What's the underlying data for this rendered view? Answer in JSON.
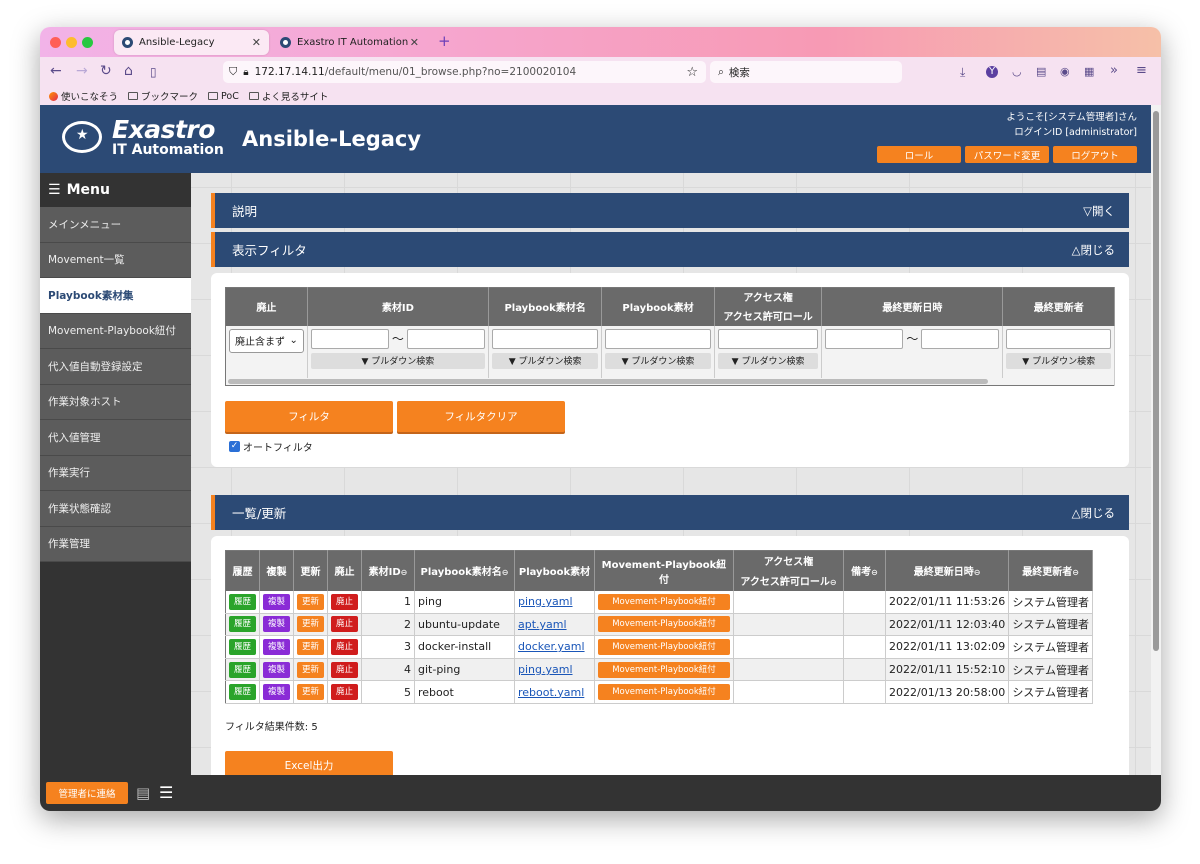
{
  "browser": {
    "tabs": [
      {
        "label": "Ansible-Legacy"
      },
      {
        "label": "Exastro IT Automation"
      }
    ],
    "new_tab": "+",
    "url_host": "172.17.14.11",
    "url_path": "/default/menu/01_browse.php?no=2100020104",
    "search_placeholder": "検索",
    "bookmarks": [
      "使いこなそう",
      "ブックマーク",
      "PoC",
      "よく見るサイト"
    ]
  },
  "header": {
    "logo_line1": "Exastro",
    "logo_line2": "IT Automation",
    "title": "Ansible-Legacy",
    "welcome": "ようこそ[システム管理者]さん",
    "login_id": "ログインID [administrator]",
    "buttons": {
      "role": "ロール",
      "password": "パスワード変更",
      "logout": "ログアウト"
    }
  },
  "sidebar": {
    "title": "Menu",
    "items": [
      {
        "label": "メインメニュー"
      },
      {
        "label": "Movement一覧"
      },
      {
        "label": "Playbook素材集"
      },
      {
        "label": "Movement-Playbook紐付"
      },
      {
        "label": "代入値自動登録設定"
      },
      {
        "label": "作業対象ホスト"
      },
      {
        "label": "代入値管理"
      },
      {
        "label": "作業実行"
      },
      {
        "label": "作業状態確認"
      },
      {
        "label": "作業管理"
      }
    ],
    "active_index": 2,
    "contact": "管理者に連絡"
  },
  "sections": {
    "description": {
      "title": "説明",
      "toggle": "▽開く"
    },
    "filter": {
      "title": "表示フィルタ",
      "toggle": "△閉じる"
    },
    "list": {
      "title": "一覧/更新",
      "toggle": "△閉じる"
    }
  },
  "filter": {
    "headers": {
      "discard": "廃止",
      "material_id": "素材ID",
      "playbook_name": "Playbook素材名",
      "playbook_file": "Playbook素材",
      "access": "アクセス権",
      "access_role": "アクセス許可ロール",
      "last_update": "最終更新日時",
      "last_updater": "最終更新者"
    },
    "discard_select": "廃止含まず",
    "range_sep": "〜",
    "pulldown": "▼ プルダウン検索",
    "filter_button": "フィルタ",
    "clear_button": "フィルタクリア",
    "auto_filter": "オートフィルタ"
  },
  "list": {
    "headers": {
      "history": "履歴",
      "copy": "複製",
      "update": "更新",
      "discard": "廃止",
      "material_id": "素材ID",
      "playbook_name": "Playbook素材名",
      "playbook_file": "Playbook素材",
      "mp_link": "Movement-Playbook紐付",
      "access": "アクセス権",
      "access_role": "アクセス許可ロール",
      "note": "備考",
      "last_update": "最終更新日時",
      "last_updater": "最終更新者"
    },
    "row_buttons": {
      "history": "履歴",
      "copy": "複製",
      "update": "更新",
      "discard": "廃止",
      "mp": "Movement-Playbook紐付"
    },
    "rows": [
      {
        "id": "1",
        "name": "ping",
        "file": "ping.yaml",
        "updated": "2022/01/11 11:53:26",
        "updater": "システム管理者"
      },
      {
        "id": "2",
        "name": "ubuntu-update",
        "file": "apt.yaml",
        "updated": "2022/01/11 12:03:40",
        "updater": "システム管理者"
      },
      {
        "id": "3",
        "name": "docker-install",
        "file": "docker.yaml",
        "updated": "2022/01/11 13:02:09",
        "updater": "システム管理者"
      },
      {
        "id": "4",
        "name": "git-ping",
        "file": "ping.yaml",
        "updated": "2022/01/11 15:52:10",
        "updater": "システム管理者"
      },
      {
        "id": "5",
        "name": "reboot",
        "file": "reboot.yaml",
        "updated": "2022/01/13 20:58:00",
        "updater": "システム管理者"
      }
    ],
    "result_count": "フィルタ結果件数: 5",
    "excel_button": "Excel出力"
  },
  "colors": {
    "brand": "#2c4a75",
    "accent": "#f5821f"
  }
}
